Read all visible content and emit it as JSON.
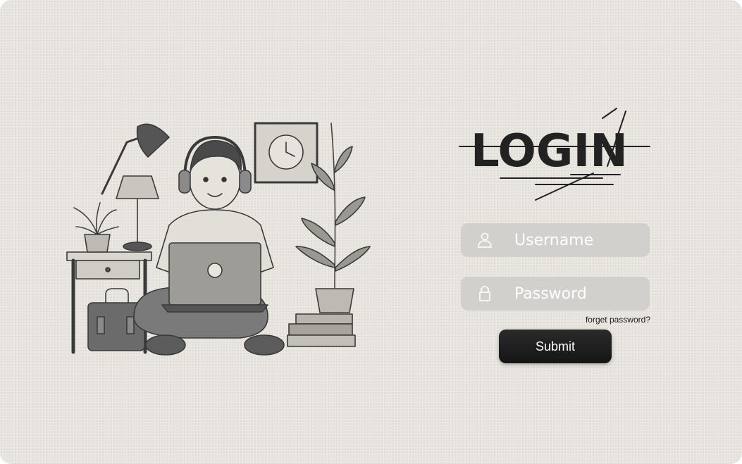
{
  "logo": {
    "text": "LOGIN"
  },
  "form": {
    "username": {
      "placeholder": "Username",
      "icon": "user-icon"
    },
    "password": {
      "placeholder": "Password",
      "icon": "lock-icon"
    },
    "forgot_label": "forget password?",
    "submit_label": "Submit"
  },
  "colors": {
    "background": "#e8e5df",
    "field": "#d2d0cd",
    "button": "#1e1e1e",
    "ink": "#1c1c1c"
  }
}
